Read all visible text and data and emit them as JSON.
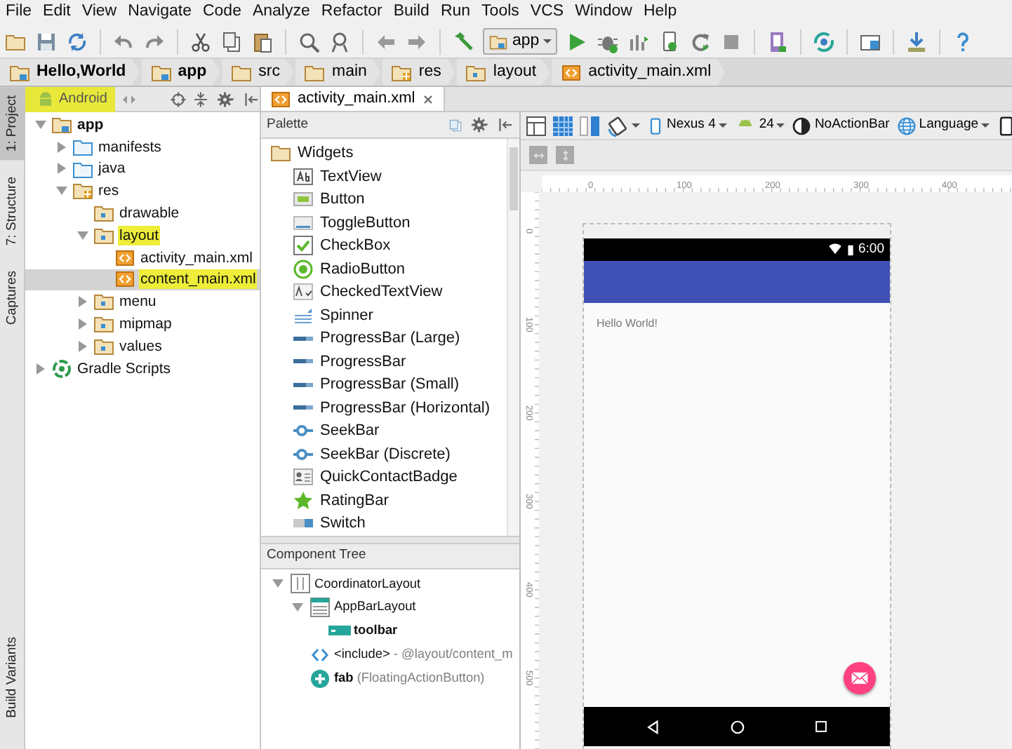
{
  "menu": [
    "File",
    "Edit",
    "View",
    "Navigate",
    "Code",
    "Analyze",
    "Refactor",
    "Build",
    "Run",
    "Tools",
    "VCS",
    "Window",
    "Help"
  ],
  "toolbar": {
    "run_config": "app"
  },
  "breadcrumbs": [
    {
      "label": "Hello,World",
      "kind": "module"
    },
    {
      "label": "app",
      "kind": "module"
    },
    {
      "label": "src",
      "kind": "folder"
    },
    {
      "label": "main",
      "kind": "folder"
    },
    {
      "label": "res",
      "kind": "res"
    },
    {
      "label": "layout",
      "kind": "pkg"
    },
    {
      "label": "activity_main.xml",
      "kind": "xml"
    }
  ],
  "side_tabs": [
    {
      "label": "1: Project",
      "selected": true
    },
    {
      "label": "7: Structure",
      "selected": false
    },
    {
      "label": "Captures",
      "selected": false
    }
  ],
  "side_tabs_bottom": [
    {
      "label": "Build Variants",
      "selected": false
    }
  ],
  "project": {
    "view": "Android",
    "highlighted": true,
    "tree": [
      {
        "label": "app",
        "kind": "module",
        "expanded": true,
        "selected": false,
        "highlighted": false,
        "children": [
          {
            "label": "manifests",
            "kind": "src",
            "expanded": false,
            "selected": false,
            "highlighted": false
          },
          {
            "label": "java",
            "kind": "src",
            "expanded": false,
            "selected": false,
            "highlighted": false
          },
          {
            "label": "res",
            "kind": "res",
            "expanded": true,
            "selected": false,
            "highlighted": false,
            "children": [
              {
                "label": "drawable",
                "kind": "pkg",
                "selected": false,
                "highlighted": false
              },
              {
                "label": "layout",
                "kind": "pkg",
                "expanded": true,
                "selected": false,
                "highlighted": true,
                "children": [
                  {
                    "label": "activity_main.xml",
                    "kind": "xml",
                    "selected": false,
                    "highlighted": false
                  },
                  {
                    "label": "content_main.xml",
                    "kind": "xml",
                    "selected": true,
                    "highlighted": true
                  }
                ]
              },
              {
                "label": "menu",
                "kind": "pkg",
                "expanded": false,
                "selected": false,
                "highlighted": false
              },
              {
                "label": "mipmap",
                "kind": "pkg",
                "expanded": false,
                "selected": false,
                "highlighted": false
              },
              {
                "label": "values",
                "kind": "pkg",
                "expanded": false,
                "selected": false,
                "highlighted": false
              }
            ]
          }
        ]
      },
      {
        "label": "Gradle Scripts",
        "kind": "gradle",
        "expanded": false,
        "selected": false,
        "highlighted": false
      }
    ]
  },
  "editor_tabs": [
    {
      "label": "activity_main.xml",
      "selected": true
    }
  ],
  "palette": {
    "title": "Palette",
    "group": "Widgets",
    "items": [
      {
        "label": "TextView",
        "kind": "textview"
      },
      {
        "label": "Button",
        "kind": "button"
      },
      {
        "label": "ToggleButton",
        "kind": "toggle"
      },
      {
        "label": "CheckBox",
        "kind": "checkbox"
      },
      {
        "label": "RadioButton",
        "kind": "radio"
      },
      {
        "label": "CheckedTextView",
        "kind": "checkedtext"
      },
      {
        "label": "Spinner",
        "kind": "spinner"
      },
      {
        "label": "ProgressBar (Large)",
        "kind": "progress"
      },
      {
        "label": "ProgressBar",
        "kind": "progress"
      },
      {
        "label": "ProgressBar (Small)",
        "kind": "progress"
      },
      {
        "label": "ProgressBar (Horizontal)",
        "kind": "progress"
      },
      {
        "label": "SeekBar",
        "kind": "seek"
      },
      {
        "label": "SeekBar (Discrete)",
        "kind": "seek"
      },
      {
        "label": "QuickContactBadge",
        "kind": "badge"
      },
      {
        "label": "RatingBar",
        "kind": "star"
      },
      {
        "label": "Switch",
        "kind": "switch"
      }
    ]
  },
  "component_tree": {
    "title": "Component Tree",
    "nodes": [
      {
        "label": "CoordinatorLayout",
        "kind": "coordinator",
        "expanded": true,
        "children": [
          {
            "label": "AppBarLayout",
            "kind": "appbar",
            "expanded": true,
            "children": [
              {
                "label": "toolbar",
                "kind": "toolbar"
              }
            ]
          },
          {
            "label": "<include>",
            "detail": " - @layout/content_m",
            "kind": "include"
          },
          {
            "label": "fab",
            "detail": " (FloatingActionButton)",
            "kind": "fab"
          }
        ]
      }
    ]
  },
  "design_toolbar": {
    "device": "Nexus 4",
    "api": "24",
    "theme": "NoActionBar",
    "locale": "Language"
  },
  "rulers": {
    "x_labels": [
      "0",
      "100",
      "200",
      "300",
      "400"
    ],
    "y_labels": [
      "0",
      "100",
      "200",
      "300",
      "400",
      "500"
    ]
  },
  "device_preview": {
    "time": "6:00",
    "text": "Hello World!"
  }
}
